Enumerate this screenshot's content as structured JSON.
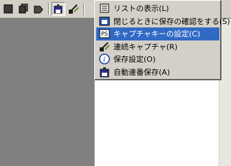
{
  "toolbar": {
    "buttons": [
      {
        "name": "stop-icon"
      },
      {
        "name": "copy-icon"
      },
      {
        "name": "arrow-icon"
      },
      {
        "name": "save-icon"
      },
      {
        "name": "continuous-capture-icon"
      }
    ]
  },
  "menu": {
    "items": [
      {
        "label": "リストの表示(L)",
        "icon": "list-icon"
      },
      {
        "label": "閉じるときに保存の確認をする(S)",
        "icon": "confirm-save-icon"
      },
      {
        "label": "キャプチャキーの設定(C)",
        "icon": "capture-key-icon",
        "selected": true
      },
      {
        "label": "連続キャプチャ(R)",
        "icon": "continuous-capture-icon"
      },
      {
        "label": "保存設定(O)",
        "icon": "info-icon"
      },
      {
        "label": "自動連番保存(A)",
        "icon": "auto-save-icon"
      }
    ]
  },
  "colors": {
    "chrome": "#d4d0c8",
    "selection": "#316ac5",
    "canvas": "#808080"
  }
}
